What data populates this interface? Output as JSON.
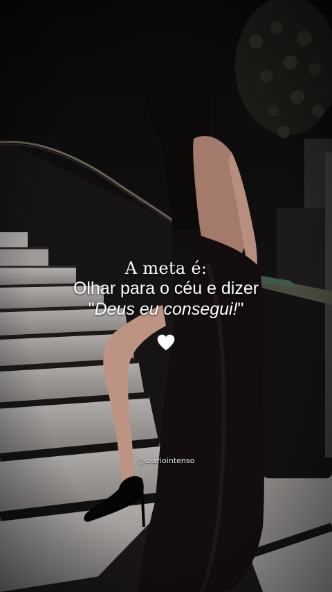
{
  "quote": {
    "title": "A meta é:",
    "line2": "Olhar para o céu e dizer",
    "line3_open": "\"",
    "line3_emph": "Deus eu consegui!",
    "line3_close": "\""
  },
  "heart_icon": "white-heart-icon",
  "handle": "@diariointenso",
  "colors": {
    "background": "#0e0d0d",
    "text": "#ffffff",
    "stairs": "#8f8c8a",
    "dress": "#120c0d",
    "skin": "#b88e7e"
  }
}
